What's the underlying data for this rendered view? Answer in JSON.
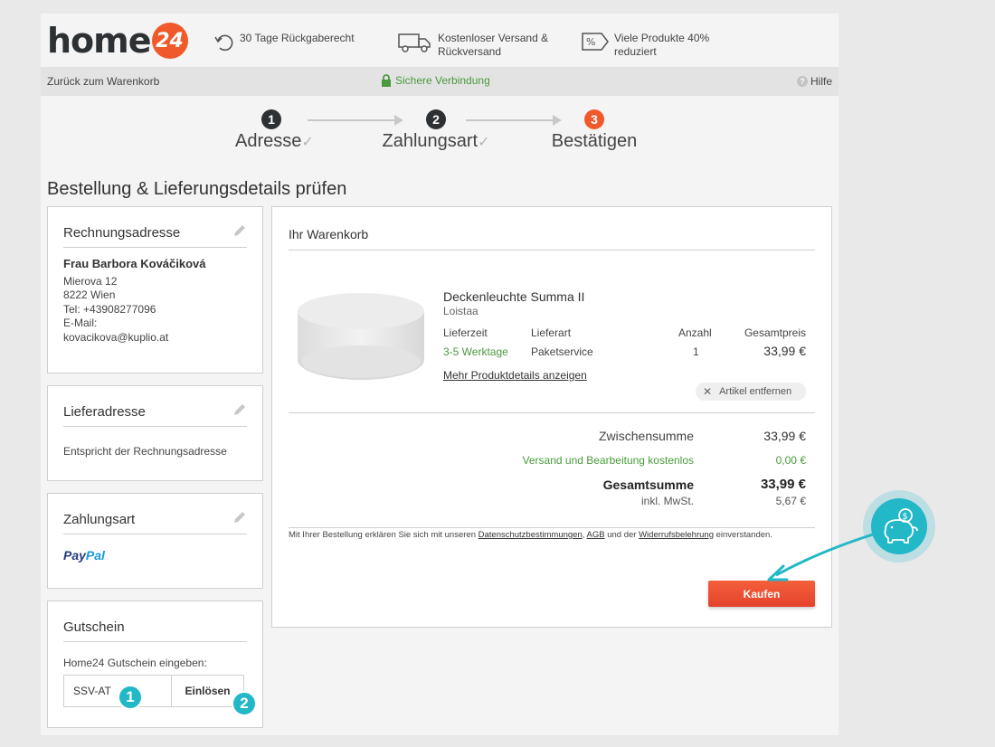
{
  "header": {
    "logo_text": "home",
    "logo_badge": "24",
    "usps": [
      {
        "icon": "return-arrow-icon",
        "line1": "30 Tage Rückgaberecht",
        "line2": ""
      },
      {
        "icon": "truck-icon",
        "line1": "Kostenloser Versand &",
        "line2": "Rückversand"
      },
      {
        "icon": "percent-tag-icon",
        "line1": "Viele Produkte 40%",
        "line2": "reduziert"
      }
    ]
  },
  "subbar": {
    "back_label": "Zurück zum Warenkorb",
    "secure_label": "Sichere Verbindung",
    "help_label": "Hilfe",
    "help_glyph": "?"
  },
  "steps": [
    {
      "num": "1",
      "label": "Adresse",
      "check": "✓"
    },
    {
      "num": "2",
      "label": "Zahlungsart",
      "check": "✓"
    },
    {
      "num": "3",
      "label": "Bestätigen",
      "check": ""
    }
  ],
  "page_title": "Bestellung & Lieferungsdetails prüfen",
  "billing": {
    "title": "Rechnungsadresse",
    "name": "Frau Barbora Kováčiková",
    "street": "Mierova 12",
    "city": "8222 Wien",
    "phone": "Tel: +43908277096",
    "email_label": "E-Mail:",
    "email": "kovacikova@kuplio.at"
  },
  "delivery": {
    "title": "Lieferadresse",
    "text": "Entspricht der Rechnungsadresse"
  },
  "payment": {
    "title": "Zahlungsart",
    "method_part1": "Pay",
    "method_part2": "Pal"
  },
  "voucher": {
    "title": "Gutschein",
    "label": "Home24 Gutschein eingeben:",
    "value": "SSV-AT",
    "button": "Einlösen"
  },
  "cart": {
    "title": "Ihr Warenkorb",
    "product": {
      "name": "Deckenleuchte Summa II",
      "brand": "Loistaa",
      "headers": {
        "lieferzeit": "Lieferzeit",
        "lieferart": "Lieferart",
        "anzahl": "Anzahl",
        "gesamtpreis": "Gesamtpreis"
      },
      "lieferzeit": "3-5 Werktage",
      "lieferart": "Paketservice",
      "anzahl": "1",
      "gesamtpreis": "33,99 €",
      "details_link": "Mehr Produktdetails anzeigen",
      "remove_label": "Artikel entfernen",
      "remove_glyph": "✕"
    },
    "summary": {
      "subtotal_label": "Zwischensumme",
      "subtotal_value": "33,99 €",
      "shipping_label": "Versand und Bearbeitung kostenlos",
      "shipping_value": "0,00 €",
      "total_label": "Gesamtsumme",
      "total_value": "33,99 €",
      "vat_label": "inkl. MwSt.",
      "vat_value": "5,67 €"
    },
    "legal": {
      "prefix": "Mit Ihrer Bestellung erklären Sie sich mit unseren ",
      "link1": "Datenschutzbestimmungen",
      "sep1": ", ",
      "link2": "AGB",
      "sep2": " und der ",
      "link3": "Widerrufsbelehrung",
      "suffix": " einverstanden."
    },
    "buy_button": "Kaufen"
  },
  "annotations": {
    "badge1": "1",
    "badge2": "2",
    "piggy_icon": "piggy-bank-icon",
    "accent_color": "#22b8c7"
  },
  "colors": {
    "brand_orange": "#f05a2b",
    "success_green": "#4a9a3d",
    "dark": "#2d3134"
  }
}
